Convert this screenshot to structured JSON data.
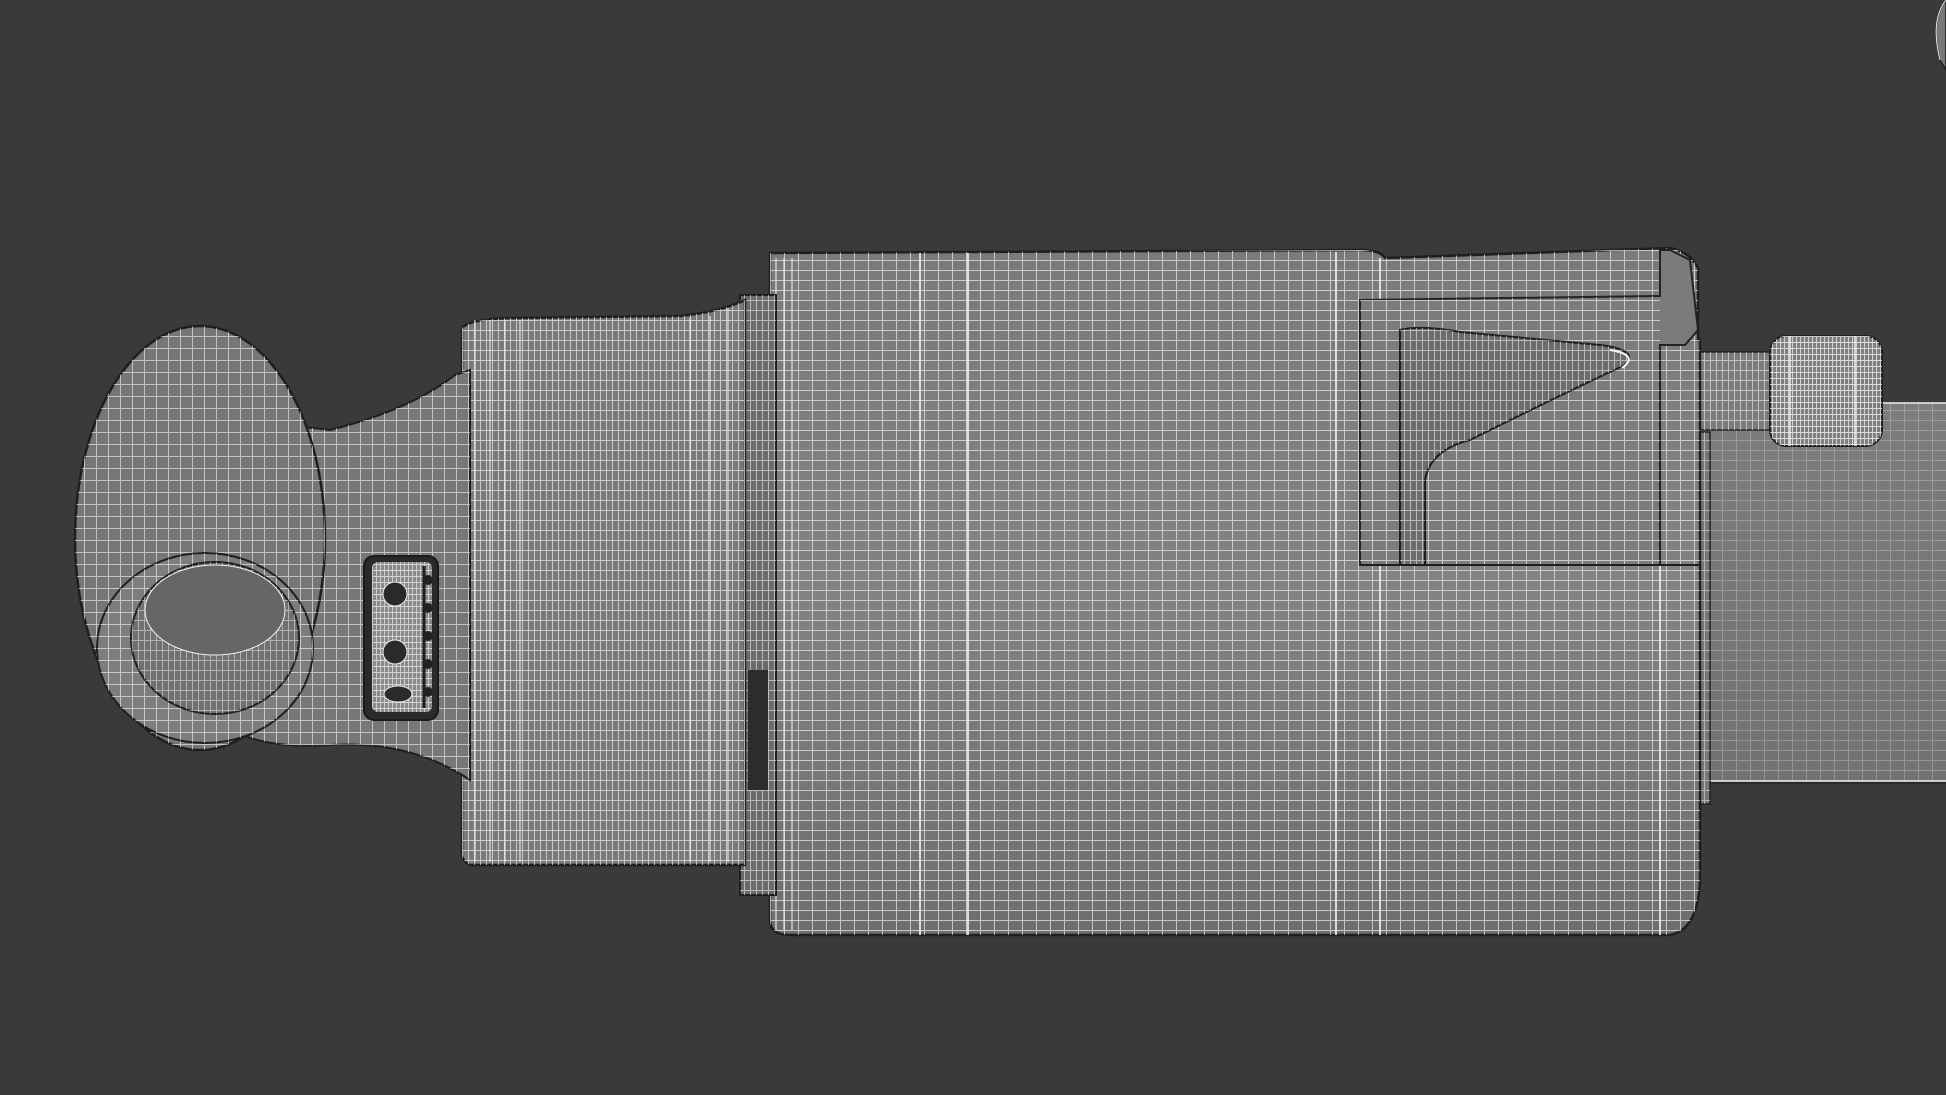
{
  "scene": {
    "subject": "wireframe-rear-shock-absorber",
    "colors": {
      "background": "#3a3a3a",
      "surface": "#7e7e7e",
      "surface_dark": "#686868",
      "wire": "#eeeeee",
      "edge": "#202020",
      "cavity": "#2c2c2c"
    }
  }
}
